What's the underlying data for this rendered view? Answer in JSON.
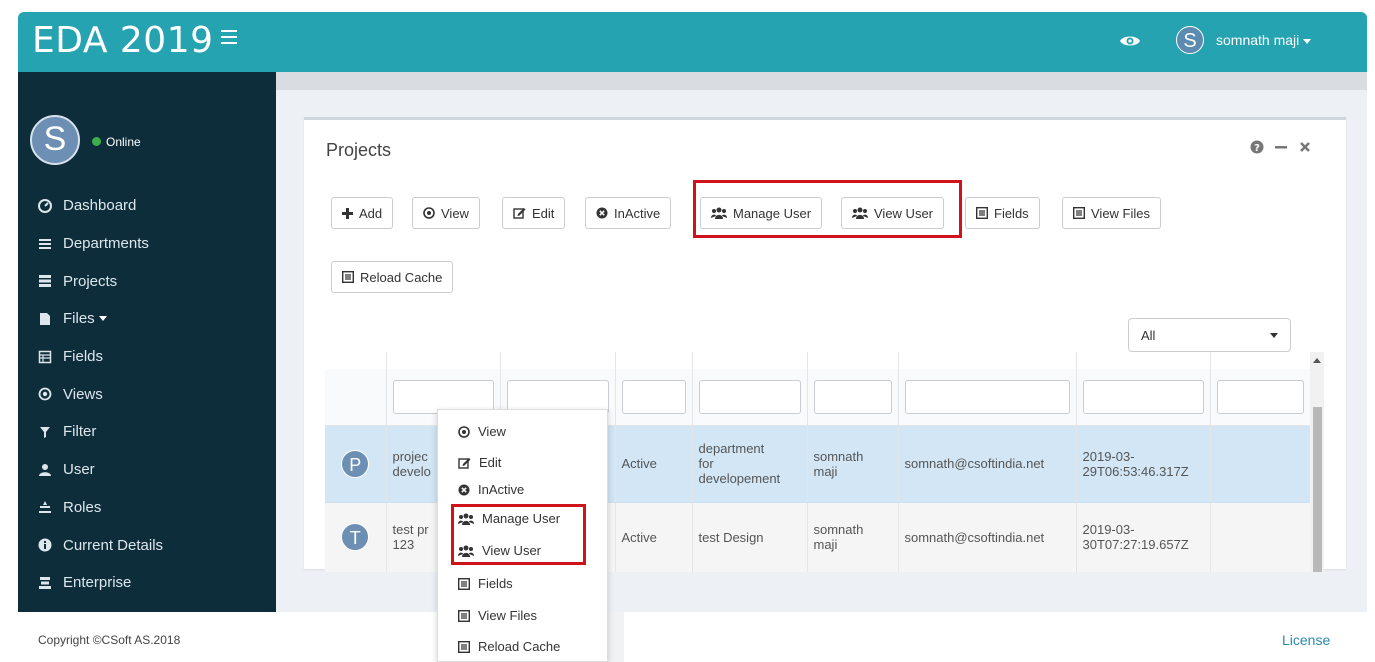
{
  "header": {
    "brand": "EDA 2019",
    "user_initial": "S",
    "username": "somnath maji",
    "accent_color": "#26a3b1"
  },
  "sidebar": {
    "avatar_initial": "S",
    "status": "Online",
    "items": [
      {
        "label": "Dashboard",
        "icon": "dashboard-icon"
      },
      {
        "label": "Departments",
        "icon": "list-icon"
      },
      {
        "label": "Projects",
        "icon": "server-icon"
      },
      {
        "label": "Files",
        "icon": "file-icon"
      },
      {
        "label": "Fields",
        "icon": "table-icon"
      },
      {
        "label": "Views",
        "icon": "circle-dot-icon"
      },
      {
        "label": "Filter",
        "icon": "filter-icon"
      },
      {
        "label": "User",
        "icon": "user-icon"
      },
      {
        "label": "Roles",
        "icon": "roles-icon"
      },
      {
        "label": "Current Details",
        "icon": "info-icon"
      },
      {
        "label": "Enterprise",
        "icon": "enterprise-icon"
      }
    ]
  },
  "panel": {
    "title": "Projects",
    "toolbar": {
      "add": "Add",
      "view": "View",
      "edit": "Edit",
      "inactive": "InActive",
      "manage_user": "Manage User",
      "view_user": "View User",
      "fields": "Fields",
      "view_files": "View Files",
      "reload_cache": "Reload Cache"
    },
    "filter_select": "All",
    "rows": [
      {
        "initial": "P",
        "name_line1": "projec",
        "name_line2": "develo",
        "status": "Active",
        "dept_line1": "department",
        "dept_line2": "for",
        "dept_line3": "developement",
        "owner_line1": "somnath",
        "owner_line2": "maji",
        "email": "somnath@csoftindia.net",
        "date_line1": "2019-03-",
        "date_line2": "29T06:53:46.317Z"
      },
      {
        "initial": "T",
        "name_line1": "test pr",
        "name_line2": "123",
        "status": "Active",
        "dept": "test Design",
        "owner_line1": "somnath",
        "owner_line2": "maji",
        "email": "somnath@csoftindia.net",
        "date_line1": "2019-03-",
        "date_line2": "30T07:27:19.657Z"
      }
    ]
  },
  "context_menu": {
    "view": "View",
    "edit": "Edit",
    "inactive": "InActive",
    "manage_user": "Manage User",
    "view_user": "View User",
    "fields": "Fields",
    "view_files": "View Files",
    "reload_cache": "Reload Cache"
  },
  "footer": {
    "copyright": "Copyright ©CSoft AS.2018",
    "license": "License"
  },
  "highlight_color": "#d0121b"
}
